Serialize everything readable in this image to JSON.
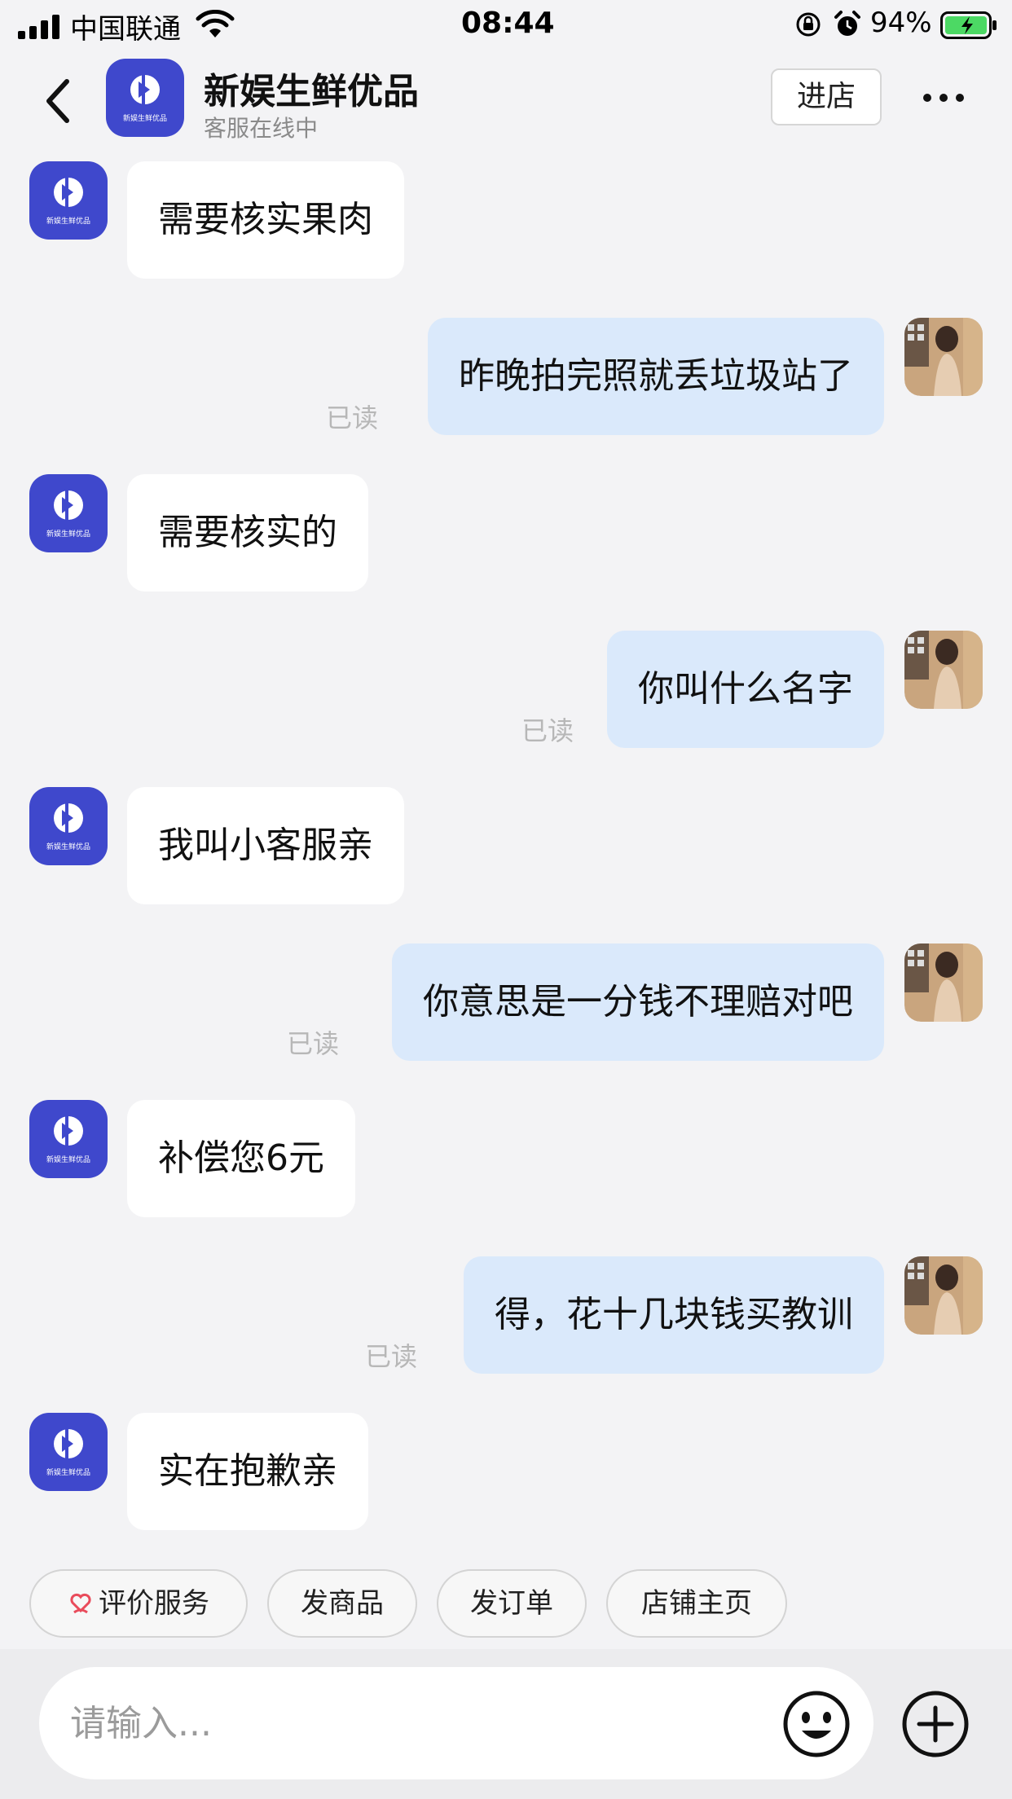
{
  "status_bar": {
    "carrier": "中国联通",
    "time": "08:44",
    "battery": "94%",
    "icons": [
      "signal-icon",
      "wifi-icon",
      "orientation-lock-icon",
      "alarm-icon",
      "battery-icon"
    ]
  },
  "header": {
    "shop_name": "新娱生鲜优品",
    "status": "客服在线中",
    "enter_store": "进店",
    "logo_text": "新娱生鲜优品",
    "icons": [
      "back-icon",
      "more-icon"
    ]
  },
  "messages": [
    {
      "side": "in",
      "text": "需要核实果肉"
    },
    {
      "side": "out",
      "text": "昨晚拍完照就丢垃圾站了",
      "read": "已读"
    },
    {
      "side": "in",
      "text": "需要核实的"
    },
    {
      "side": "out",
      "text": "你叫什么名字",
      "read": "已读"
    },
    {
      "side": "in",
      "text": "我叫小客服亲"
    },
    {
      "side": "out",
      "text": "你意思是一分钱不理赔对吧",
      "read": "已读"
    },
    {
      "side": "in",
      "text": "补偿您6元"
    },
    {
      "side": "out",
      "text": "得，花十几块钱买教训",
      "read": "已读"
    },
    {
      "side": "in",
      "text": "实在抱歉亲"
    }
  ],
  "quick_actions": [
    {
      "label": "评价服务",
      "icon": "heart-hands-icon"
    },
    {
      "label": "发商品"
    },
    {
      "label": "发订单"
    },
    {
      "label": "店铺主页"
    }
  ],
  "input": {
    "placeholder": "请输入...",
    "icons": [
      "emoji-icon",
      "plus-icon"
    ]
  },
  "colors": {
    "brand": "#3f48cc",
    "bubble_out": "#dae9fb",
    "bubble_in": "#ffffff",
    "background": "#f3f3f5",
    "battery": "#4cd964"
  }
}
